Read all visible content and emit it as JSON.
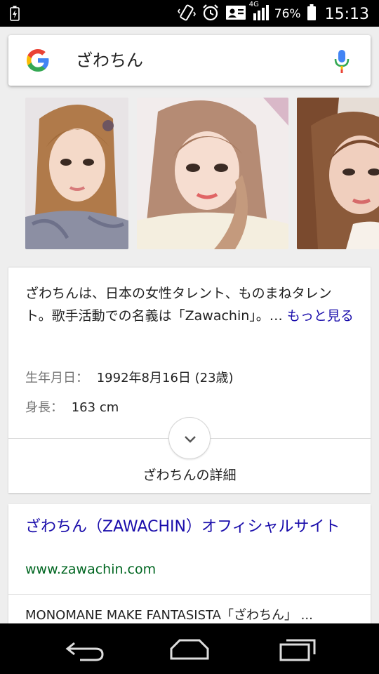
{
  "status_bar": {
    "network": "4G",
    "battery": "76%",
    "time": "15:13"
  },
  "search": {
    "query": "ざわちん"
  },
  "images": [
    {
      "name": "image-1"
    },
    {
      "name": "image-2"
    },
    {
      "name": "image-3"
    }
  ],
  "knowledge": {
    "description": "ざわちんは、日本の女性タレント、ものまねタレント。歌手活動での名義は「Zawachin」。…",
    "more_link": "もっと見る",
    "facts": [
      {
        "label": "生年月日：",
        "value": "1992年8月16日 (23歳)"
      },
      {
        "label": "身長：",
        "value": "163 cm"
      }
    ],
    "details_label": "ざわちんの詳細"
  },
  "result": {
    "title": "ざわちん（ZAWACHIN）オフィシャルサイト",
    "url": "www.zawachin.com",
    "snippet": "MONOMANE MAKE FANTASISTA「ざわちん」 ..."
  },
  "colors": {
    "link_blue": "#1a0dab",
    "url_green": "#006621",
    "label_gray": "#757575"
  }
}
